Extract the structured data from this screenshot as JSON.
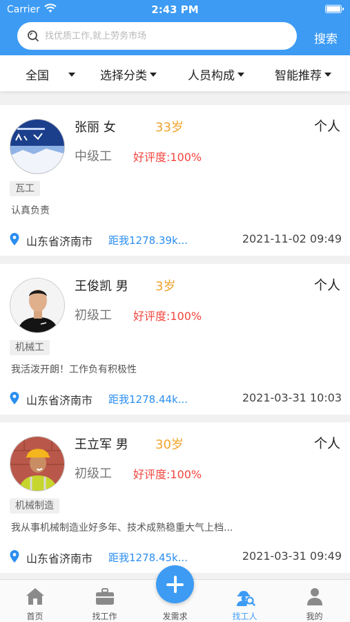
{
  "status": {
    "carrier": "Carrier",
    "time": "2:43 PM"
  },
  "search": {
    "placeholder": "找优质工作,就上劳务市场",
    "button": "搜索"
  },
  "filters": [
    {
      "label": "全国"
    },
    {
      "label": "选择分类"
    },
    {
      "label": "人员构成"
    },
    {
      "label": "智能推荐"
    }
  ],
  "workers": [
    {
      "name": "张丽 女",
      "age": "33岁",
      "type": "个人",
      "level": "中级工",
      "rating": "好评度:100%",
      "tag": "瓦工",
      "desc": "认真负责",
      "location": "山东省济南市",
      "distance": "距我1278.39k...",
      "date": "2021-11-02 09:49"
    },
    {
      "name": "王俊凯 男",
      "age": "3岁",
      "type": "个人",
      "level": "初级工",
      "rating": "好评度:100%",
      "tag": "机械工",
      "desc": "我活泼开朗！工作负有积极性",
      "location": "山东省济南市",
      "distance": "距我1278.44k...",
      "date": "2021-03-31 10:03"
    },
    {
      "name": "王立军 男",
      "age": "30岁",
      "type": "个人",
      "level": "初级工",
      "rating": "好评度:100%",
      "tag": "机械制造",
      "desc": "我从事机械制造业好多年、技术成熟稳重大气上档...",
      "location": "山东省济南市",
      "distance": "距我1278.45k...",
      "date": "2021-03-31 09:49"
    }
  ],
  "tabbar": {
    "home": "首页",
    "find_job": "找工作",
    "post": "发需求",
    "find_worker": "找工人",
    "mine": "我的"
  },
  "colors": {
    "primary": "#3d9bf4",
    "age": "#f0a42d",
    "rating": "#f2443d",
    "distance": "#2b8ef0"
  },
  "icons": {
    "home": "home-icon",
    "find_job": "briefcase-icon",
    "post": "plus-icon",
    "find_worker": "worker-search-icon",
    "mine": "user-icon",
    "location": "location-pin-icon"
  }
}
